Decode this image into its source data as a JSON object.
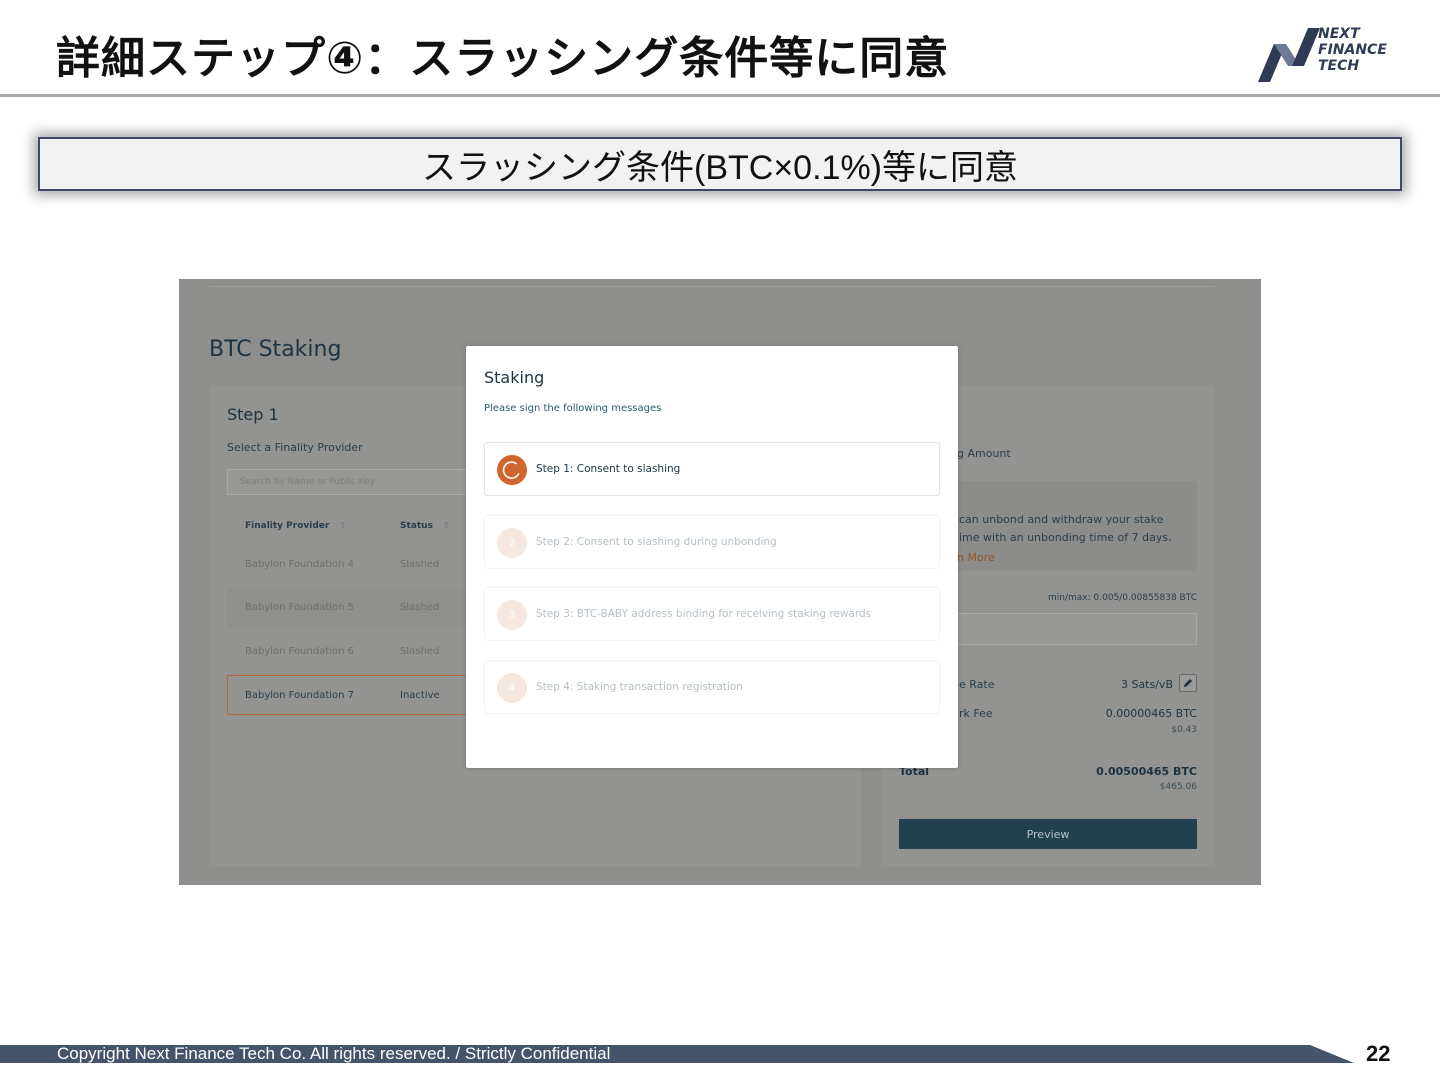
{
  "slide": {
    "title": "詳細ステップ④：スラッシング条件等に同意",
    "subtitle": "スラッシング条件(BTC×0.1%)等に同意",
    "logo_lines": [
      "NEXT",
      "FINANCE",
      "TECH"
    ],
    "footer": "Copyright Next Finance Tech Co. All rights reserved. / Strictly Confidential",
    "page_number": "22"
  },
  "app": {
    "page_heading": "BTC Staking",
    "step1": {
      "heading": "Step 1",
      "select_label": "Select a Finality Provider",
      "search_placeholder": "Search by Name or Public Key",
      "columns": [
        "Finality Provider",
        "Status"
      ],
      "rows": [
        {
          "name": "Babylon Foundation 4",
          "status": "Slashed"
        },
        {
          "name": "Babylon Foundation 5",
          "status": "Slashed"
        },
        {
          "name": "Babylon Foundation 6",
          "status": "Slashed"
        },
        {
          "name": "Babylon Foundation 7",
          "status": "Inactive"
        }
      ]
    },
    "right_panel": {
      "amount_label": "g Amount",
      "info_line1": "can unbond and withdraw your stake",
      "info_line2": "ime with an unbonding time of 7 days.",
      "learn_more": "n More",
      "minmax": "min/max: 0.005/0.00855838 BTC",
      "fee_rate_label": "e Rate",
      "fee_rate_value": "3 Sats/vB",
      "network_fee_label": "rk Fee",
      "network_fee_btc": "0.00000465 BTC",
      "network_fee_usd": "$0.43",
      "total_label": "Total",
      "total_btc": "0.00500465 BTC",
      "total_usd": "$465.06",
      "preview_button": "Preview"
    },
    "modal": {
      "title": "Staking",
      "subtitle": "Please sign the following messages",
      "steps": [
        {
          "badge": "",
          "label": "Step 1: Consent to slashing",
          "active": true
        },
        {
          "badge": "2",
          "label": "Step 2: Consent to slashing during unbonding",
          "active": false
        },
        {
          "badge": "3",
          "label": "Step 3: BTC-BABY address binding for receiving staking rewards",
          "active": false
        },
        {
          "badge": "4",
          "label": "Step 4: Staking transaction registration",
          "active": false
        }
      ]
    }
  },
  "colors": {
    "accent_orange": "#d1652f",
    "navy": "#23404f",
    "footer_bar": "#44546a"
  }
}
